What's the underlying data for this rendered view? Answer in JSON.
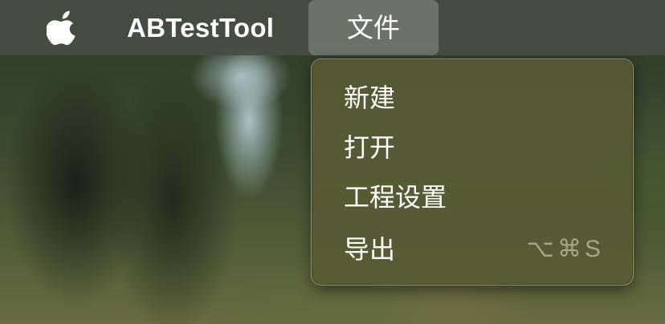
{
  "menubar": {
    "apple_icon": "apple-logo-icon",
    "app_name": "ABTestTool",
    "file_menu_label": "文件"
  },
  "file_menu": {
    "items": [
      {
        "label": "新建",
        "shortcut": ""
      },
      {
        "label": "打开",
        "shortcut": ""
      },
      {
        "label": "工程设置",
        "shortcut": ""
      },
      {
        "label": "导出",
        "shortcut": "⌥⌘S"
      }
    ]
  },
  "colors": {
    "menubar_bg": "#464e42",
    "menu_bg": "#585a34",
    "text": "#ffffff",
    "shortcut_text": "#bebeaa"
  }
}
